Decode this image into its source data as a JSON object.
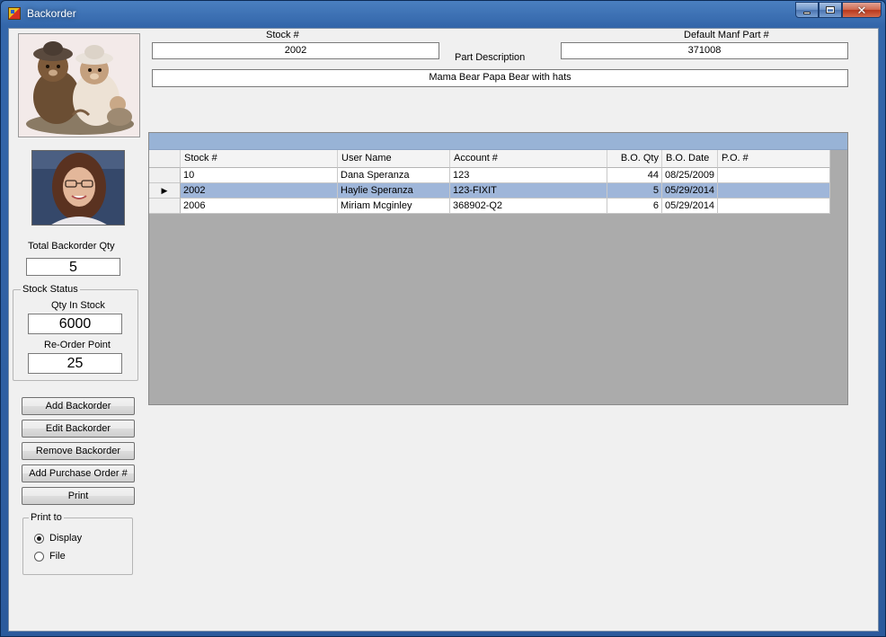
{
  "window": {
    "title": "Backorder"
  },
  "header": {
    "stock_label": "Stock #",
    "stock_value": "2002",
    "manf_label": "Default Manf Part #",
    "manf_value": "371008",
    "desc_label": "Part Description",
    "desc_value": "Mama Bear  Papa Bear with hats"
  },
  "totals": {
    "total_label": "Total Backorder Qty",
    "total_value": "5"
  },
  "stock_status": {
    "group_label": "Stock Status",
    "qty_label": "Qty In Stock",
    "qty_value": "6000",
    "reorder_label": "Re-Order Point",
    "reorder_value": "25"
  },
  "buttons": {
    "add": "Add Backorder",
    "edit": "Edit Backorder",
    "remove": "Remove Backorder",
    "add_po": "Add Purchase Order #",
    "print": "Print"
  },
  "print_to": {
    "group_label": "Print to",
    "options": [
      "Display",
      "File"
    ],
    "selected": "Display"
  },
  "grid": {
    "columns": [
      "Stock #",
      "User Name",
      "Account #",
      "B.O. Qty",
      "B.O. Date",
      "P.O. #"
    ],
    "rows": [
      {
        "stock": "10",
        "user": "Dana Speranza",
        "account": "123",
        "qty": "44",
        "date": "08/25/2009",
        "po": ""
      },
      {
        "stock": "2002",
        "user": "Haylie Speranza",
        "account": "123-FIXIT",
        "qty": "5",
        "date": "05/29/2014",
        "po": "",
        "selected": true
      },
      {
        "stock": "2006",
        "user": "Miriam Mcginley",
        "account": "368902-Q2",
        "qty": "6",
        "date": "05/29/2014",
        "po": ""
      }
    ]
  },
  "colors": {
    "titlebar": "#2b5a9c",
    "selected_row": "#9fb6d9",
    "grid_caption": "#98b3d6",
    "grid_bg": "#ababab"
  }
}
